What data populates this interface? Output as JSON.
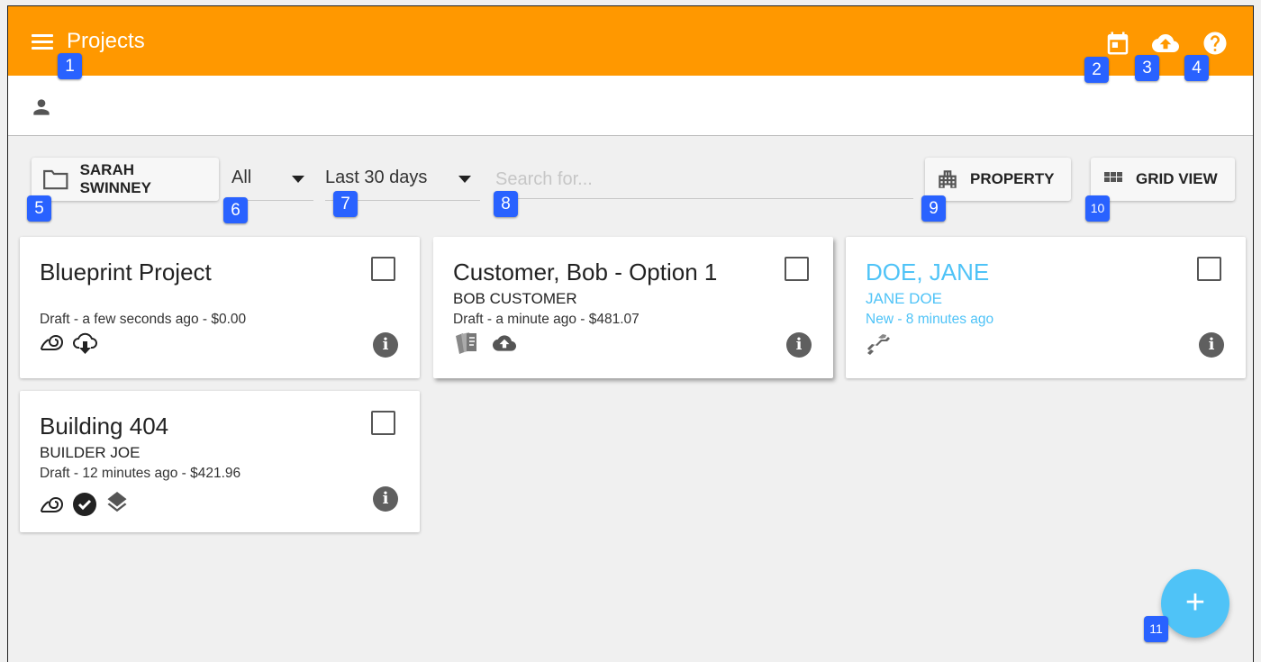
{
  "header": {
    "title": "Projects",
    "icons": [
      "menu-icon",
      "calendar-icon",
      "cloud-upload-icon",
      "help-icon"
    ],
    "accent_color": "#ff9800"
  },
  "user_bar": {
    "icon": "person-icon"
  },
  "toolbar": {
    "folder_button_label": "SARAH SWINNEY",
    "status_filter": "All",
    "date_filter": "Last 30 days",
    "search_placeholder": "Search for...",
    "property_button_label": "PROPERTY",
    "grid_view_button_label": "GRID VIEW"
  },
  "cards": [
    {
      "title": "Blueprint Project",
      "subtitle": "",
      "meta": "Draft - a few seconds ago - $0.00",
      "icons": [
        "roll-icon",
        "cloud-download-icon"
      ],
      "highlight": false
    },
    {
      "title": "Customer, Bob - Option 1",
      "subtitle": "BOB CUSTOMER",
      "meta": "Draft - a minute ago - $481.07",
      "icons": [
        "papers-icon",
        "cloud-upload-icon"
      ],
      "highlight": false
    },
    {
      "title": "DOE, JANE",
      "subtitle": "JANE DOE",
      "meta": "New - 8 minutes ago",
      "icons": [
        "handshake-icon"
      ],
      "highlight": true,
      "highlight_color": "#4fc3f7"
    },
    {
      "title": "Building 404",
      "subtitle": "BUILDER JOE",
      "meta": "Draft - 12 minutes ago - $421.96",
      "icons": [
        "roll-icon",
        "check-circle-icon",
        "layers-icon"
      ],
      "highlight": false
    }
  ],
  "fab": {
    "label": "+",
    "color": "#4fc3f7"
  },
  "annotations": [
    "1",
    "2",
    "3",
    "4",
    "5",
    "6",
    "7",
    "8",
    "9",
    "10",
    "11"
  ],
  "annotation_color": "#2962ff"
}
